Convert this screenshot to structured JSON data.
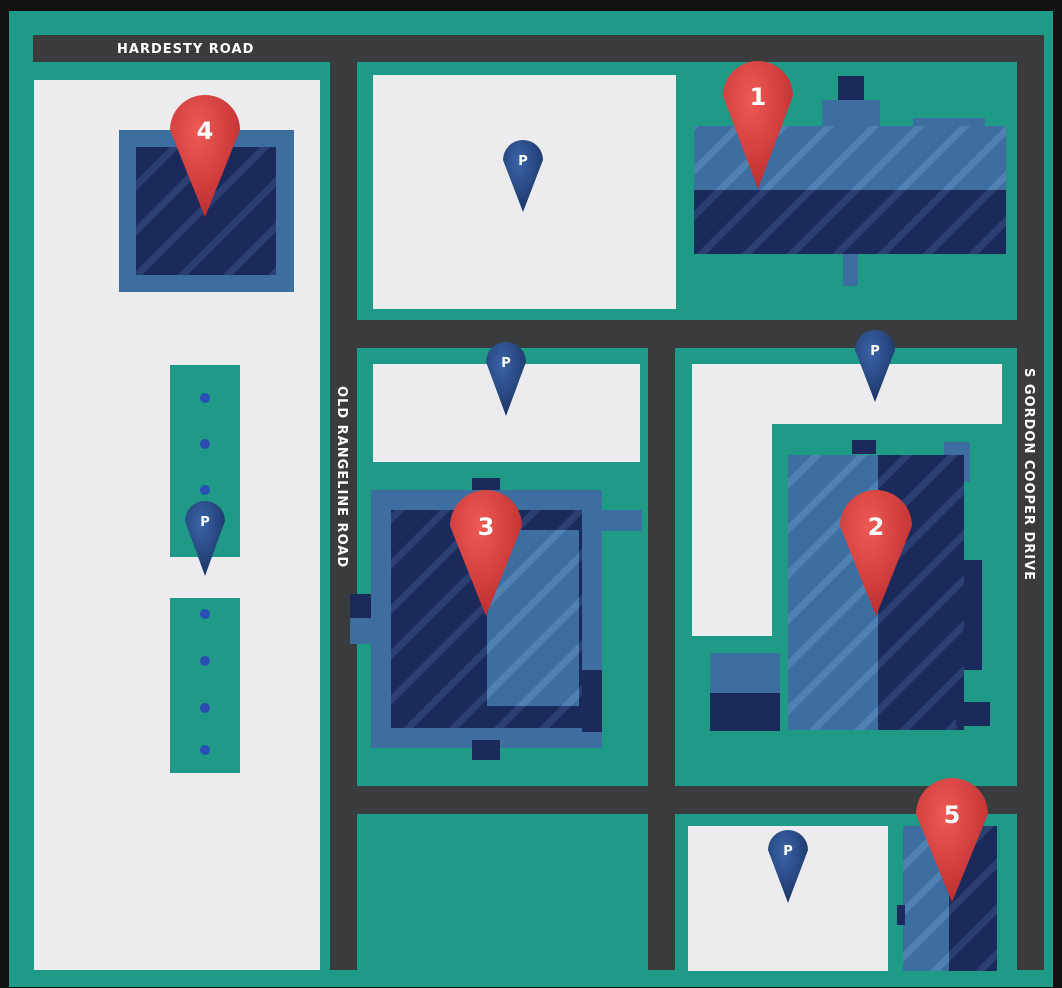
{
  "colors": {
    "background": "#111111",
    "grass": "#1e9a86",
    "road": "#3a3b3d",
    "parking_lot": "#ececee",
    "building_dark": "#1b2a5a",
    "building_light": "#3c6ea0",
    "marker_red": "#d63a3a",
    "marker_blue": "#1f3f78",
    "dot_blue": "#2b4fb0"
  },
  "roads": {
    "north": "HARDESTY ROAD",
    "west_inner": "OLD RANGELINE ROAD",
    "east": "S GORDON COOPER DRIVE"
  },
  "location_markers": [
    {
      "id": "1",
      "label": "1"
    },
    {
      "id": "2",
      "label": "2"
    },
    {
      "id": "3",
      "label": "3"
    },
    {
      "id": "4",
      "label": "4"
    },
    {
      "id": "5",
      "label": "5"
    }
  ],
  "parking_markers": [
    {
      "id": "p1",
      "label": "P"
    },
    {
      "id": "p2",
      "label": "P"
    },
    {
      "id": "p3",
      "label": "P"
    },
    {
      "id": "p4",
      "label": "P"
    },
    {
      "id": "p5",
      "label": "P"
    }
  ]
}
